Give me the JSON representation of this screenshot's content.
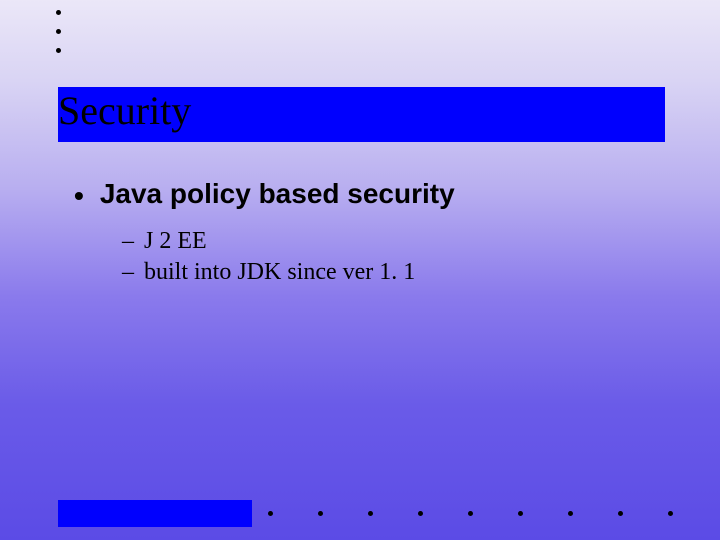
{
  "title": "Security",
  "bullets": [
    {
      "text": "Java policy based security",
      "sub": [
        "J 2 EE",
        "built into JDK since ver 1. 1"
      ]
    }
  ],
  "markers": {
    "level1": "•",
    "level2": "–"
  }
}
